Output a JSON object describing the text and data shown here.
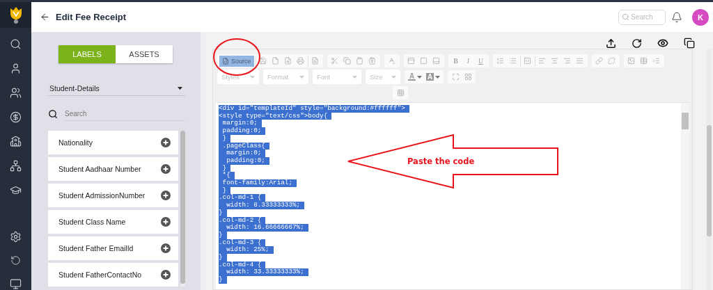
{
  "header": {
    "title": "Edit Fee Receipt",
    "search": {
      "placeholder": "Search"
    },
    "avatar": "K"
  },
  "left_panel": {
    "tabs": [
      {
        "label": "LABELS",
        "selected": true
      },
      {
        "label": "ASSETS",
        "selected": false
      }
    ],
    "category": "Student-Details",
    "search": {
      "placeholder": "Search"
    },
    "fields": [
      "Nationality",
      "Student Aadhaar Number",
      "Student AdmissionNumber",
      "Student Class Name",
      "Student Father EmailId",
      "Student FatherContactNo"
    ]
  },
  "editor": {
    "toolbar": {
      "source": {
        "label": "Source",
        "on": true
      },
      "format_letters": [
        "B",
        "I",
        "U"
      ],
      "dropdowns": [
        "Styles",
        "Format",
        "Font",
        "Size"
      ],
      "color_buttons": [
        "A",
        "A"
      ]
    },
    "source_lines": [
      "<div id=\"templateId\" style=\"background:#ffffff\">",
      "<style type=\"text/css\">body{",
      " margin:0;",
      " padding:0;",
      " }",
      " .pageClass{",
      "  margin:0;",
      "  padding:0;",
      " }",
      " *{",
      " font-family:Arial;",
      " }",
      ".col-md-1 {",
      "  width: 8.33333333%;",
      "}",
      ".col-md-2 {",
      "  width: 16.66666667%;",
      "}",
      ".col-md-3 {",
      "  width: 25%;",
      "}",
      ".col-md-4 {",
      "  width: 33.33333333%;",
      "}"
    ],
    "selected": true
  },
  "annotation": {
    "text": "Paste the code"
  }
}
